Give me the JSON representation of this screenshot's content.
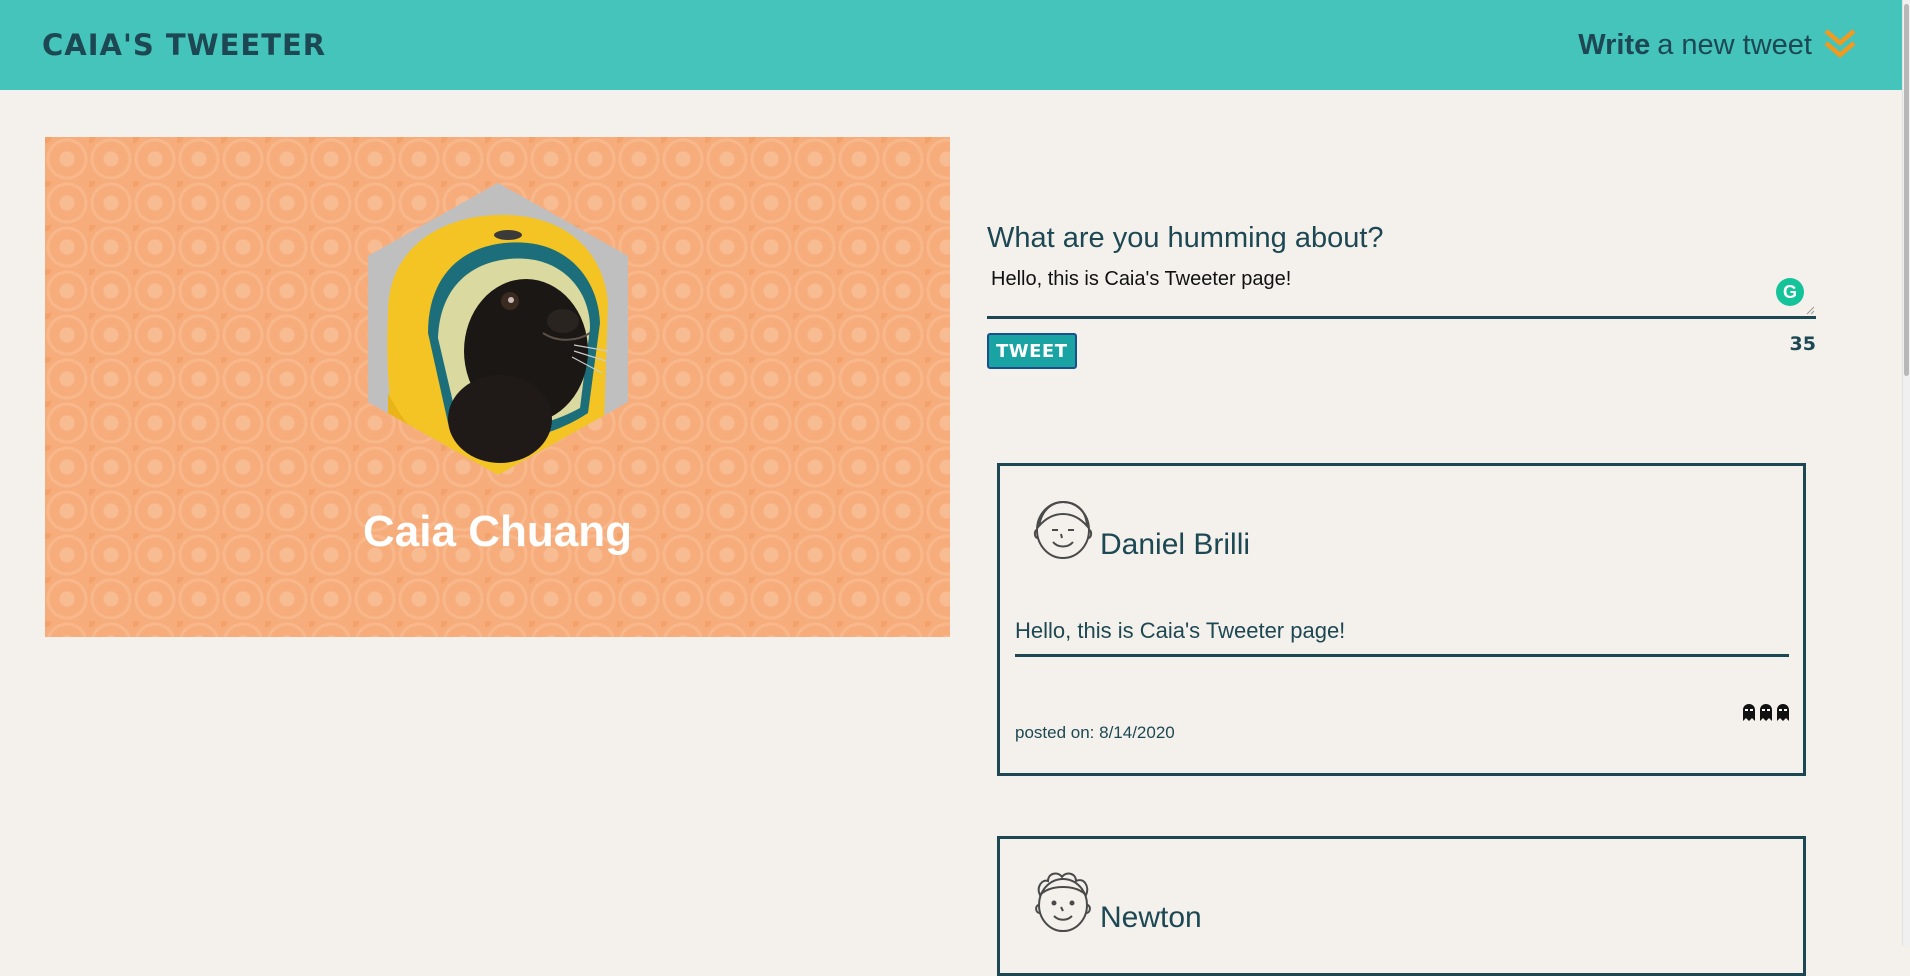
{
  "nav": {
    "brand": "CAIA'S TWEETER",
    "compose_bold": "Write",
    "compose_rest": "a new tweet",
    "compose_icon": "double-chevron-down-icon"
  },
  "profile": {
    "name": "Caia Chuang",
    "avatar": "pug-in-yellow-hoodie-photo",
    "background_color": "#f7ad7b"
  },
  "compose": {
    "label": "What are you humming about?",
    "value": "Hello, this is Caia's Tweeter page!",
    "button_label": "TWEET",
    "counter": "35"
  },
  "tweets": [
    {
      "author": "Daniel Brilli",
      "avatar_icon": "smiling-face-icon",
      "text": "Hello, this is Caia's Tweeter page!",
      "posted": "posted on: 8/14/2020",
      "action_icons": [
        "flag-icon",
        "retweet-icon",
        "like-icon"
      ]
    },
    {
      "author": "Newton",
      "avatar_icon": "curly-hair-face-icon"
    }
  ],
  "colors": {
    "nav": "#44c4bb",
    "text": "#1d4853",
    "page_bg": "#f4f1ec",
    "accent": "#f29a1f",
    "button": "#19a3a3"
  }
}
